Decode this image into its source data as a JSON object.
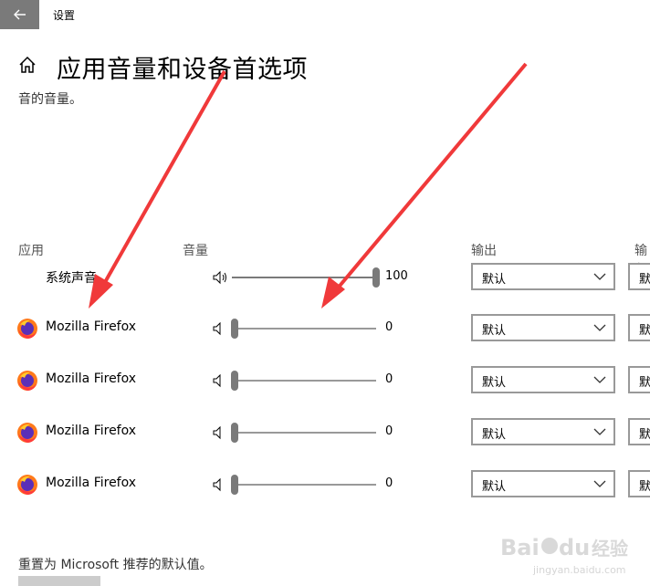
{
  "window": {
    "title": "设置"
  },
  "header": {
    "title": "应用音量和设备首选项",
    "subtitle": "音的音量。"
  },
  "columns": {
    "app": "应用",
    "volume": "音量",
    "output": "输出",
    "input": "输入"
  },
  "rows": [
    {
      "name": "系统声音",
      "icon": "system-sound",
      "volume": 100,
      "volume_text": "100",
      "output": "默认",
      "input": "默认"
    },
    {
      "name": "Mozilla Firefox",
      "icon": "firefox-icon",
      "volume": 0,
      "volume_text": "0",
      "output": "默认",
      "input": "默认"
    },
    {
      "name": "Mozilla Firefox",
      "icon": "firefox-icon",
      "volume": 0,
      "volume_text": "0",
      "output": "默认",
      "input": "默认"
    },
    {
      "name": "Mozilla Firefox",
      "icon": "firefox-icon",
      "volume": 0,
      "volume_text": "0",
      "output": "默认",
      "input": "默认"
    },
    {
      "name": "Mozilla Firefox",
      "icon": "firefox-icon",
      "volume": 0,
      "volume_text": "0",
      "output": "默认",
      "input": "默认"
    }
  ],
  "footer": {
    "reset_text": "重置为 Microsoft 推荐的默认值。"
  },
  "watermark": {
    "brand": "Baidu",
    "text": "经验",
    "url": "jingyan.baidu.com"
  },
  "colors": {
    "annotation_arrow": "#f0393a",
    "back_button": "#7a7a7a",
    "slider": "#7a7a7a"
  }
}
